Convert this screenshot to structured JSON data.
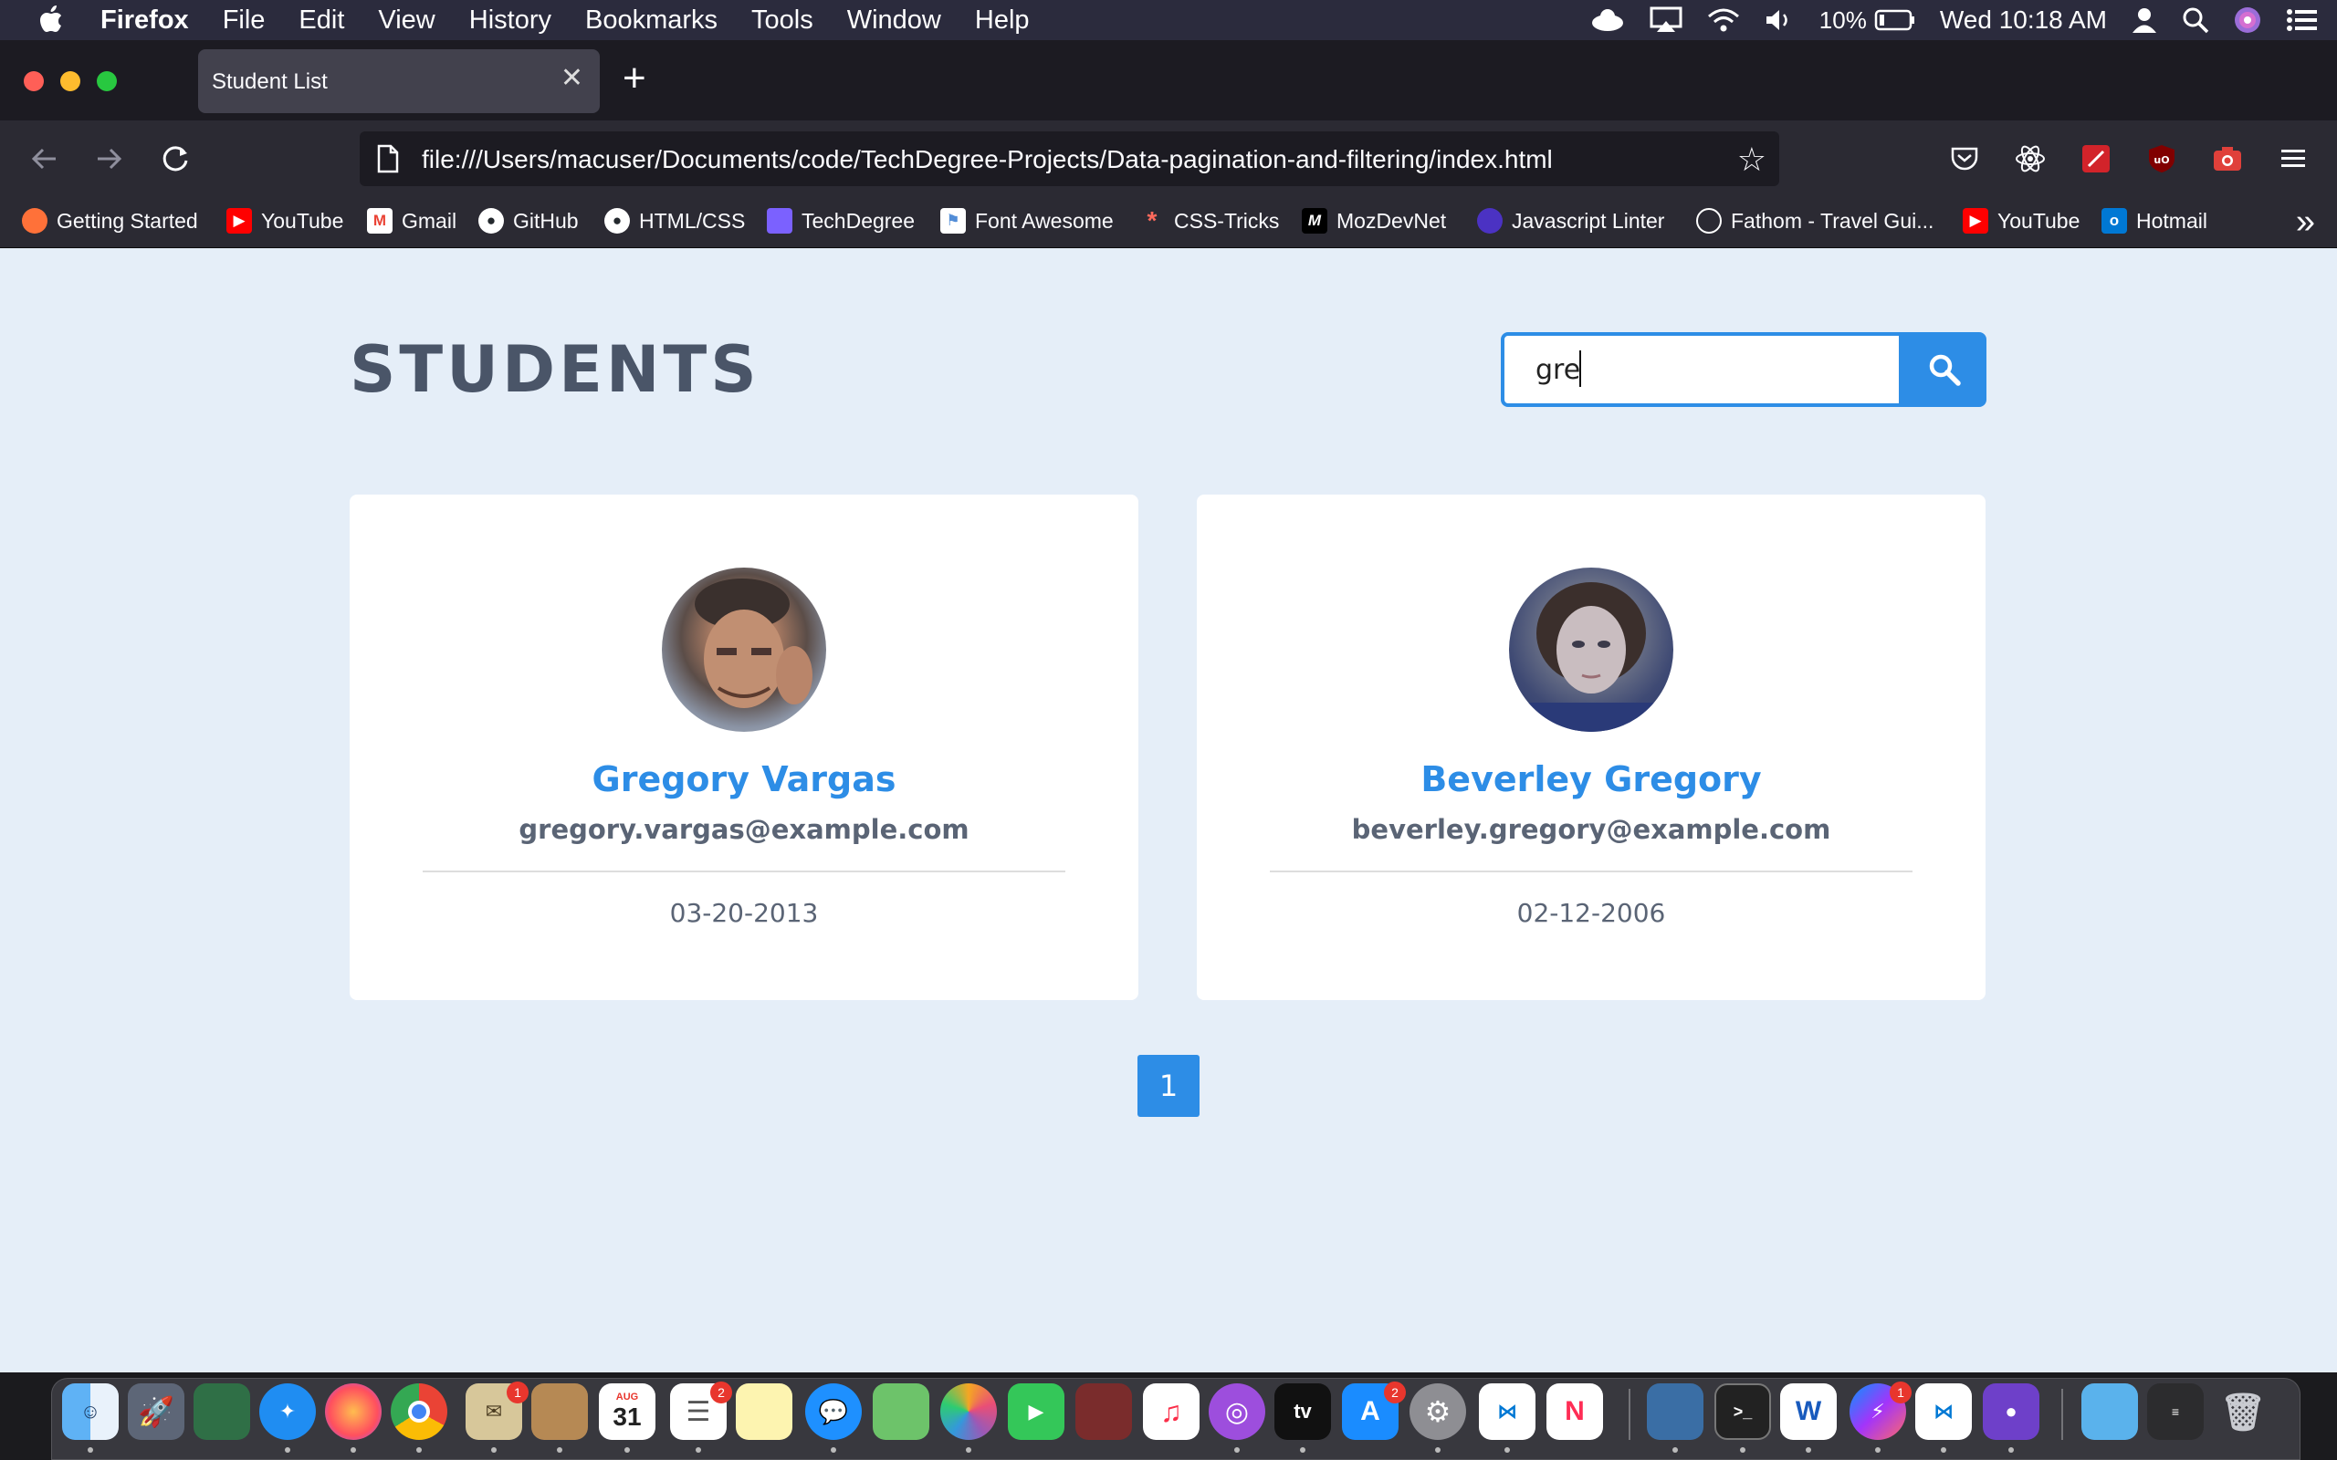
{
  "menubar": {
    "app_name": "Firefox",
    "items": [
      "File",
      "Edit",
      "View",
      "History",
      "Bookmarks",
      "Tools",
      "Window",
      "Help"
    ],
    "battery": "10%",
    "clock": "Wed 10:18 AM"
  },
  "browser": {
    "tab_title": "Student List",
    "url": "file:///Users/macuser/Documents/code/TechDegree-Projects/Data-pagination-and-filtering/index.html",
    "bookmarks": [
      {
        "label": "Getting Started",
        "icon": "firefox-icon",
        "color": "#ff7139"
      },
      {
        "label": "YouTube",
        "icon": "youtube-icon",
        "color": "#ff0000"
      },
      {
        "label": "Gmail",
        "icon": "gmail-icon",
        "color": "#ea4335"
      },
      {
        "label": "GitHub",
        "icon": "github-icon",
        "color": "#ffffff"
      },
      {
        "label": "HTML/CSS",
        "icon": "github-icon",
        "color": "#ffffff"
      },
      {
        "label": "TechDegree",
        "icon": "techdegree-icon",
        "color": "#7b61ff"
      },
      {
        "label": "Font Awesome",
        "icon": "flag-icon",
        "color": "#528dd7"
      },
      {
        "label": "CSS-Tricks",
        "icon": "asterisk-icon",
        "color": "#ff6a5c"
      },
      {
        "label": "MozDevNet",
        "icon": "mdn-icon",
        "color": "#000000"
      },
      {
        "label": "Javascript Linter",
        "icon": "linter-icon",
        "color": "#4b32c3"
      },
      {
        "label": "Fathom - Travel Gui...",
        "icon": "globe-icon",
        "color": "#ffffff"
      },
      {
        "label": "YouTube",
        "icon": "youtube-icon",
        "color": "#ff0000"
      },
      {
        "label": "Hotmail",
        "icon": "outlook-icon",
        "color": "#0078d4"
      }
    ]
  },
  "page": {
    "title": "STUDENTS",
    "search_value": "gre",
    "accent_color": "#2d8de6",
    "students": [
      {
        "name": "Gregory Vargas",
        "email": "gregory.vargas@example.com",
        "date": "03-20-2013"
      },
      {
        "name": "Beverley Gregory",
        "email": "beverley.gregory@example.com",
        "date": "02-12-2006"
      }
    ],
    "pagination": [
      "1"
    ]
  },
  "dock": {
    "calendar_month": "AUG",
    "calendar_day": "31",
    "badges": {
      "mail": "1",
      "reminders": "2",
      "appstore": "2",
      "messenger": "1"
    }
  }
}
